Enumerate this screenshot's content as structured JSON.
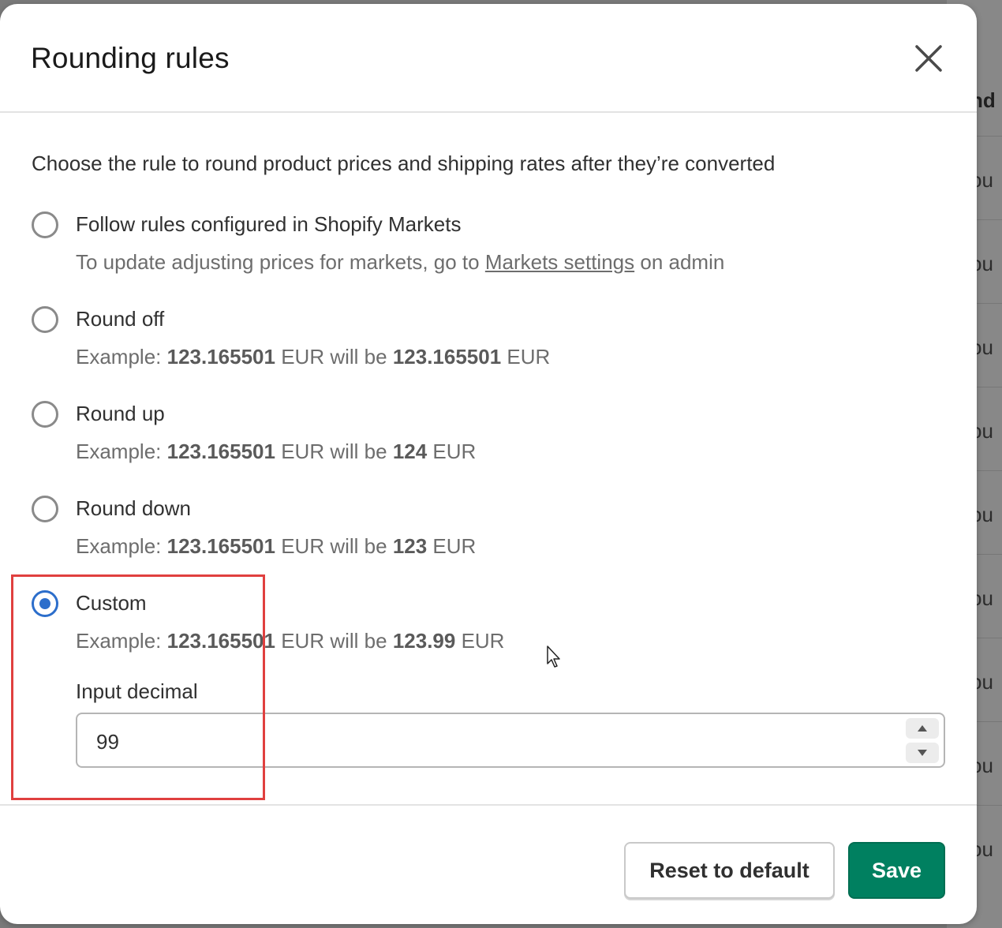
{
  "background": {
    "header_fragment": "nd",
    "row_fragments": [
      "ou",
      "ou",
      "ou",
      "ou",
      "ou",
      "ou",
      "ou",
      "ou",
      "ou"
    ]
  },
  "modal": {
    "title": "Rounding rules",
    "description": "Choose the rule to round product prices and shipping rates after they’re converted",
    "options": [
      {
        "label": "Follow rules configured in Shopify Markets",
        "help_prefix": "To update adjusting prices for markets, go to ",
        "help_link": "Markets settings",
        "help_suffix": " on admin",
        "selected": false
      },
      {
        "label": "Round off",
        "example_prefix": "Example: ",
        "example_from": "123.165501",
        "example_mid": " EUR will be ",
        "example_to": "123.165501",
        "example_suffix": " EUR",
        "selected": false
      },
      {
        "label": "Round up",
        "example_prefix": "Example: ",
        "example_from": "123.165501",
        "example_mid": " EUR will be ",
        "example_to": "124",
        "example_suffix": " EUR",
        "selected": false
      },
      {
        "label": "Round down",
        "example_prefix": "Example: ",
        "example_from": "123.165501",
        "example_mid": " EUR will be ",
        "example_to": "123",
        "example_suffix": " EUR",
        "selected": false
      },
      {
        "label": "Custom",
        "example_prefix": "Example: ",
        "example_from": "123.165501",
        "example_mid": " EUR will be ",
        "example_to": "123.99",
        "example_suffix": " EUR",
        "selected": true
      }
    ],
    "input": {
      "label": "Input decimal",
      "value": "99"
    },
    "footer": {
      "reset_label": "Reset to default",
      "save_label": "Save"
    },
    "colors": {
      "primary": "#008060",
      "radio_selected": "#2c6ecb",
      "highlight": "#e0403f"
    }
  }
}
